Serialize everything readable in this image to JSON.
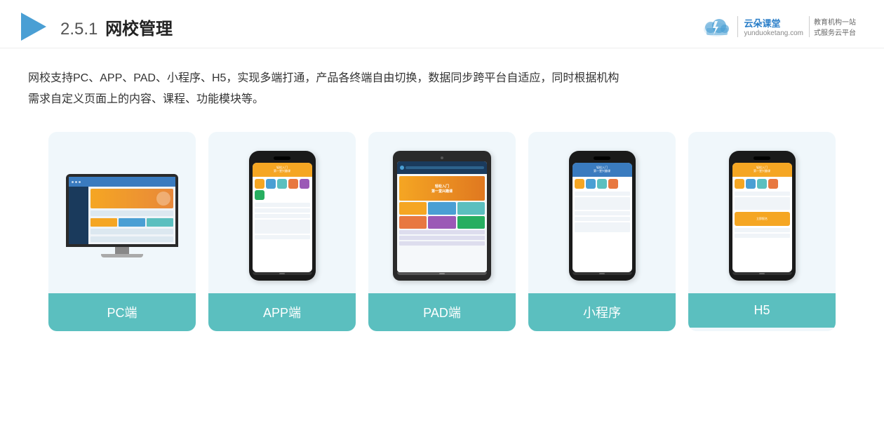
{
  "header": {
    "section_num": "2.5.1",
    "section_name": "网校管理",
    "brand_name": "云朵课堂",
    "brand_url": "yunduoketang.com",
    "brand_slogan_line1": "教育机构一站",
    "brand_slogan_line2": "式服务云平台"
  },
  "description": {
    "text_line1": "网校支持PC、APP、PAD、小程序、H5，实现多端打通，产品各终端自由切换，数据同步跨平台自适应，同时根据机构",
    "text_line2": "需求自定义页面上的内容、课程、功能模块等。"
  },
  "cards": [
    {
      "id": "pc",
      "label": "PC端",
      "device_type": "pc"
    },
    {
      "id": "app",
      "label": "APP端",
      "device_type": "phone"
    },
    {
      "id": "pad",
      "label": "PAD端",
      "device_type": "tablet"
    },
    {
      "id": "miniprogram",
      "label": "小程序",
      "device_type": "phone2"
    },
    {
      "id": "h5",
      "label": "H5",
      "device_type": "phone3"
    }
  ],
  "colors": {
    "accent": "#5bbfbf",
    "header_blue": "#4a9fd4",
    "orange": "#f5a623"
  }
}
